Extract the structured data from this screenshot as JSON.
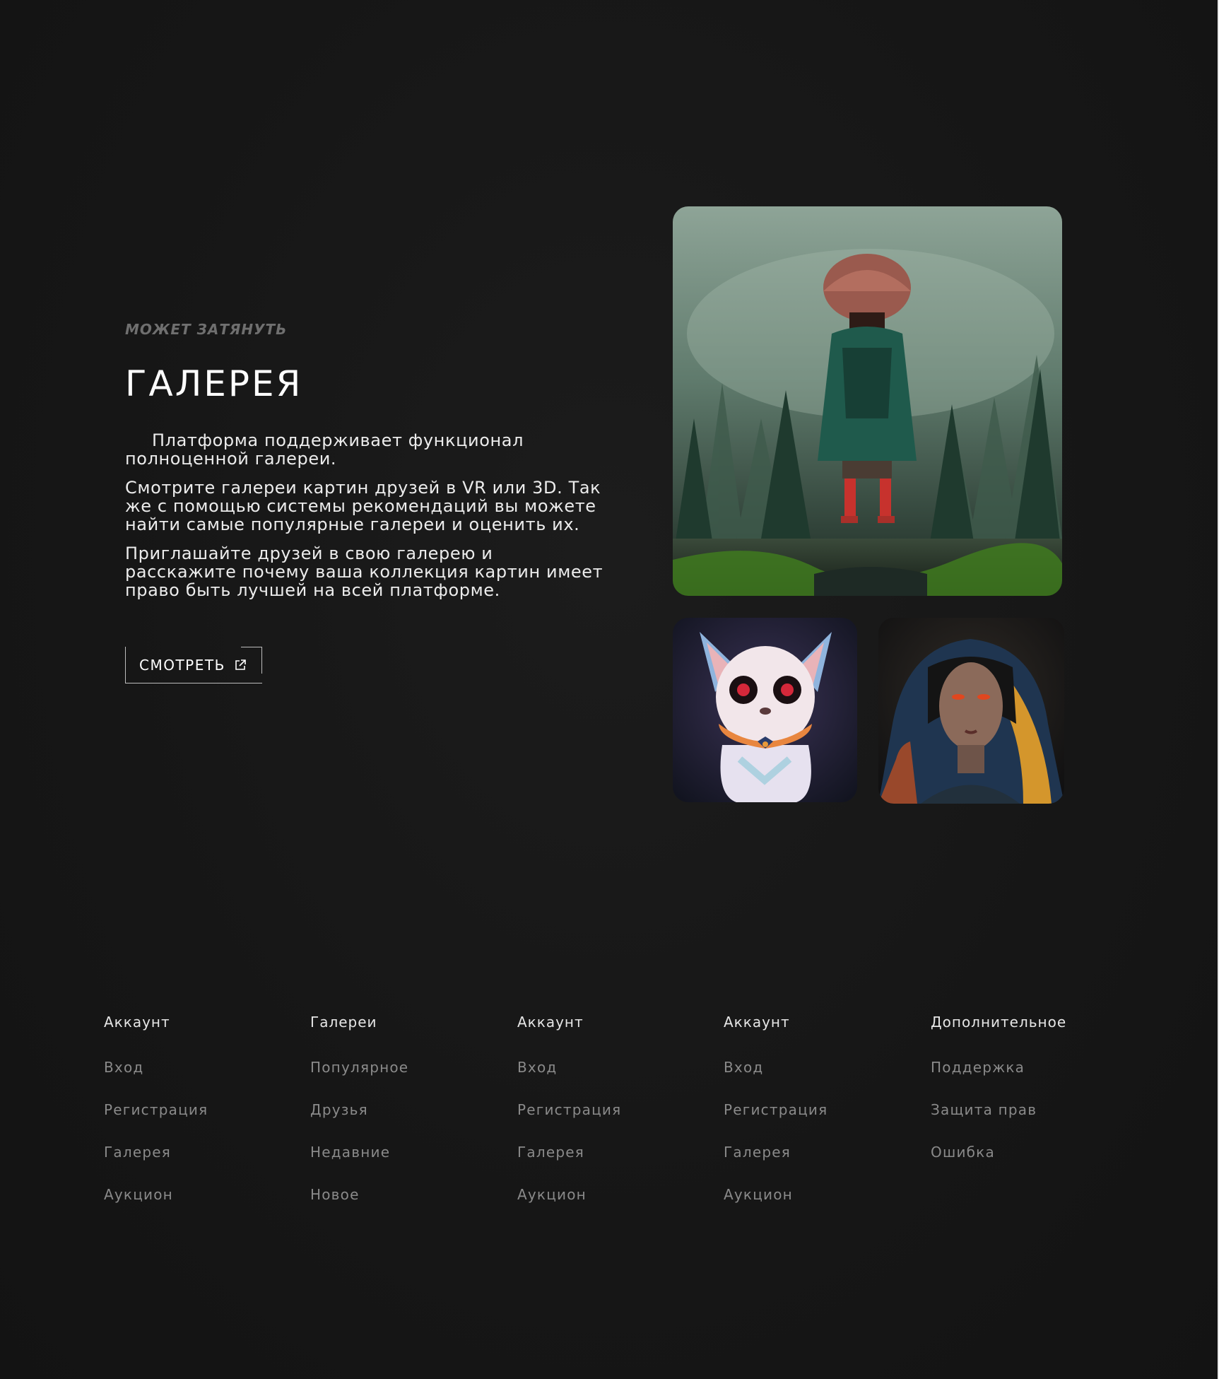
{
  "hero": {
    "eyebrow": "МОЖЕТ ЗАТЯНУТЬ",
    "title": "ГАЛЕРЕЯ",
    "paragraphs": [
      "Платформа поддерживает функционал полноценной галереи.",
      "Смотрите галереи картин друзей в VR или 3D. Так же с помощью системы рекомендаций вы можете найти самые популярные галереи и оценить их.",
      "Приглашайте друзей в свою галерею и расскажите почему ваша коллекция картин имеет право быть лучшей на всей платформе."
    ],
    "button_label": "СМОТРЕТЬ",
    "button_icon": "external-link-icon"
  },
  "images": {
    "main": "girl-in-forest-image",
    "cat": "white-cat-portrait-image",
    "woman": "hooded-woman-portrait-image"
  },
  "footer": {
    "columns": [
      {
        "title": "Аккаунт",
        "links": [
          "Вход",
          "Регистрация",
          "Галерея",
          "Аукцион"
        ]
      },
      {
        "title": "Галереи",
        "links": [
          "Популярное",
          "Друзья",
          "Недавние",
          "Новое"
        ]
      },
      {
        "title": "Аккаунт",
        "links": [
          "Вход",
          "Регистрация",
          "Галерея",
          "Аукцион"
        ]
      },
      {
        "title": "Аккаунт",
        "links": [
          "Вход",
          "Регистрация",
          "Галерея",
          "Аукцион"
        ]
      },
      {
        "title": "Дополнительное",
        "links": [
          "Поддержка",
          "Защита прав",
          "Ошибка"
        ]
      }
    ]
  },
  "colors": {
    "background": "#161616",
    "text": "#ececec",
    "muted": "#8a8a8a",
    "eyebrow": "#6f6f6f"
  }
}
